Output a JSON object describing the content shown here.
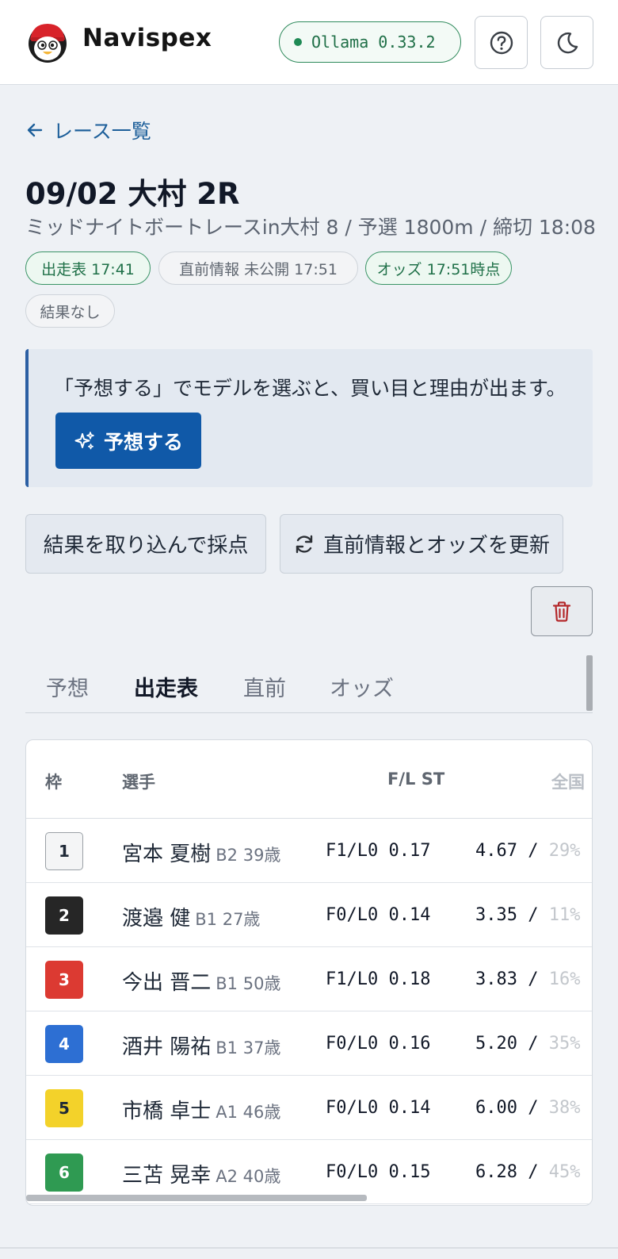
{
  "header": {
    "brand": "Navispex",
    "version_label": "Ollama 0.33.2",
    "help_icon": "question-circle-icon",
    "theme_icon": "moon-icon"
  },
  "nav": {
    "back_label": "レース一覧"
  },
  "race": {
    "title": "09/02 大村 2R",
    "subtitle": "ミッドナイトボートレースin大村 8 / 予選 1800m / 締切 18:08"
  },
  "chips": [
    {
      "label": "出走表 17:41",
      "style": "green"
    },
    {
      "label": "直前情報 未公開 17:51",
      "style": "gray"
    },
    {
      "label": "オッズ 17:51時点",
      "style": "green"
    },
    {
      "label": "結果なし",
      "style": "gray"
    }
  ],
  "info": {
    "message": "「予想する」でモデルを選ぶと、買い目と理由が出ます。",
    "predict_label": "予想する"
  },
  "actions": {
    "score_label": "結果を取り込んで採点",
    "refresh_label": "直前情報とオッズを更新",
    "delete_icon": "trash-icon"
  },
  "tabs": [
    {
      "label": "予想",
      "active": false
    },
    {
      "label": "出走表",
      "active": true
    },
    {
      "label": "直前",
      "active": false
    },
    {
      "label": "オッズ",
      "active": false
    }
  ],
  "table": {
    "headers": [
      "枠",
      "選手",
      "F/L ST",
      "全国"
    ],
    "rows": [
      {
        "frame": "1",
        "name": "宮本 夏樹",
        "meta": "B2 39歳",
        "fl_st": "F1/L0 0.17",
        "rate": "4.67 / ",
        "rate_pct": "29%",
        "bg": "#f4f5f6",
        "fg": "#1f2937",
        "border": "#9aa0a6"
      },
      {
        "frame": "2",
        "name": "渡邉 健",
        "meta": "B1 27歳",
        "fl_st": "F0/L0 0.14",
        "rate": "3.35 / ",
        "rate_pct": "11%",
        "bg": "#262626",
        "fg": "#ffffff",
        "border": "#262626"
      },
      {
        "frame": "3",
        "name": "今出 晋二",
        "meta": "B1 50歳",
        "fl_st": "F1/L0 0.18",
        "rate": "3.83 / ",
        "rate_pct": "16%",
        "bg": "#dc3a32",
        "fg": "#ffffff",
        "border": "#dc3a32"
      },
      {
        "frame": "4",
        "name": "酒井 陽祐",
        "meta": "B1 37歳",
        "fl_st": "F0/L0 0.16",
        "rate": "5.20 / ",
        "rate_pct": "35%",
        "bg": "#2d6fd3",
        "fg": "#ffffff",
        "border": "#2d6fd3"
      },
      {
        "frame": "5",
        "name": "市橋 卓士",
        "meta": "A1 46歳",
        "fl_st": "F0/L0 0.14",
        "rate": "6.00 / ",
        "rate_pct": "38%",
        "bg": "#f3d22a",
        "fg": "#1f2937",
        "border": "#f3d22a"
      },
      {
        "frame": "6",
        "name": "三苫 晃幸",
        "meta": "A2 40歳",
        "fl_st": "F0/L0 0.15",
        "rate": "6.28 / ",
        "rate_pct": "45%",
        "bg": "#2f9a52",
        "fg": "#ffffff",
        "border": "#2f9a52"
      }
    ]
  }
}
